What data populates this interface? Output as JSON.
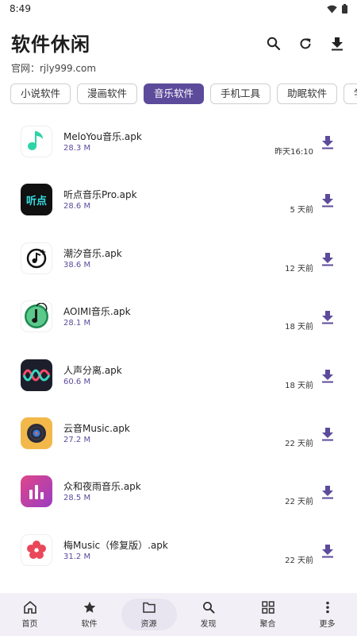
{
  "status": {
    "time": "8:49"
  },
  "header": {
    "title": "软件休闲",
    "site": "官网：rjly999.com"
  },
  "categories": [
    "小说软件",
    "漫画软件",
    "音乐软件",
    "手机工具",
    "助眠软件",
    "学"
  ],
  "active_category": "音乐软件",
  "apps": [
    {
      "name": "MeloYou音乐.apk",
      "size": "28.3 M",
      "time": "昨天16:10",
      "icon": "music-note-icon"
    },
    {
      "name": "听点音乐Pro.apk",
      "size": "28.6 M",
      "time": "5 天前",
      "icon": "tingdian-logo-icon",
      "icon_text": "听点"
    },
    {
      "name": "潮汐音乐.apk",
      "size": "38.6 M",
      "time": "12 天前",
      "icon": "tide-music-icon"
    },
    {
      "name": "AOIMI音乐.apk",
      "size": "28.1 M",
      "time": "18 天前",
      "icon": "green-note-icon"
    },
    {
      "name": "人声分离.apk",
      "size": "60.6 M",
      "time": "18 天前",
      "icon": "waveform-icon"
    },
    {
      "name": "云音Music.apk",
      "size": "27.2 M",
      "time": "22 天前",
      "icon": "vinyl-icon"
    },
    {
      "name": "众和夜雨音乐.apk",
      "size": "28.5 M",
      "time": "22 天前",
      "icon": "bar-chart-icon"
    },
    {
      "name": "梅Music（修复版）.apk",
      "size": "31.2 M",
      "time": "22 天前",
      "icon": "plum-blossom-icon"
    }
  ],
  "nav": [
    {
      "label": "首页",
      "icon": "home-icon"
    },
    {
      "label": "软件",
      "icon": "star-icon"
    },
    {
      "label": "资源",
      "icon": "folder-icon"
    },
    {
      "label": "发现",
      "icon": "search-icon"
    },
    {
      "label": "聚合",
      "icon": "grid-icon"
    },
    {
      "label": "更多",
      "icon": "more-icon"
    }
  ],
  "colors": {
    "accent": "#5c4b9b",
    "nav_bg": "#f2f0f6"
  }
}
